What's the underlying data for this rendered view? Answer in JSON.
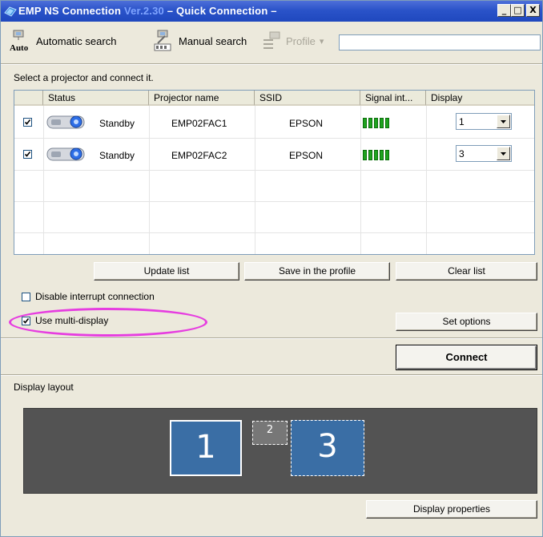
{
  "window": {
    "title_main": "EMP NS Connection",
    "title_version": "Ver.2.30",
    "title_suffix": "– Quick Connection –",
    "controls": {
      "minimize": "_",
      "maximize": "□",
      "close": "X"
    }
  },
  "toolbar": {
    "auto_icon_text": "Auto",
    "automatic_search": "Automatic search",
    "manual_search": "Manual search",
    "profile": "Profile",
    "profile_arrow": "▾",
    "profile_value": ""
  },
  "instruction": "Select a projector and connect it.",
  "table": {
    "columns": [
      "Status",
      "Projector name",
      "SSID",
      "Signal int...",
      "Display"
    ],
    "rows": [
      {
        "checked": true,
        "status": "Standby",
        "projector_name": "EMP02FAC1",
        "ssid": "EPSON",
        "signal_bars": 5,
        "display": "1"
      },
      {
        "checked": true,
        "status": "Standby",
        "projector_name": "EMP02FAC2",
        "ssid": "EPSON",
        "signal_bars": 5,
        "display": "3"
      }
    ]
  },
  "buttons": {
    "update_list": "Update list",
    "save_profile": "Save in the profile",
    "clear_list": "Clear list",
    "set_options": "Set options",
    "connect": "Connect",
    "display_properties": "Display properties"
  },
  "options": {
    "disable_interrupt": {
      "label": "Disable interrupt connection",
      "checked": false
    },
    "use_multi_display": {
      "label": "Use multi-display",
      "checked": true
    }
  },
  "display_layout": {
    "label": "Display layout",
    "displays": [
      "1",
      "2",
      "3"
    ]
  },
  "colors": {
    "highlight": "#e63de0",
    "title_bar": "#2a53c9",
    "display_blue": "#3a6ea5",
    "layout_bg": "#535353",
    "signal": "#1ea31e"
  }
}
